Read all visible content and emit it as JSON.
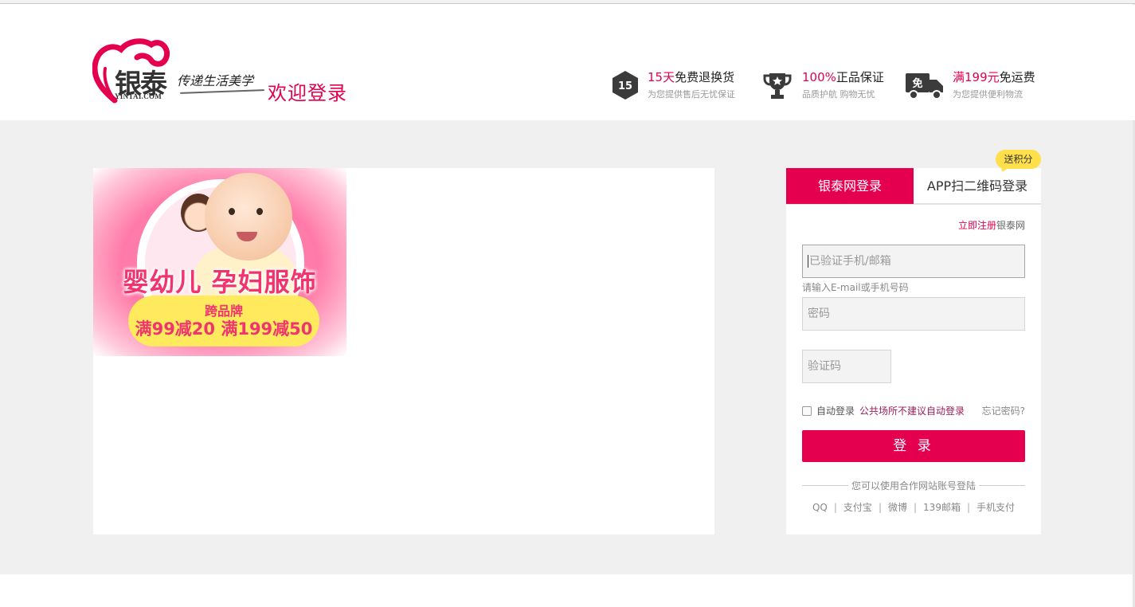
{
  "header": {
    "logo_cn": "银泰",
    "logo_en": "YINTAI.COM",
    "slogan": "传递生活美学",
    "welcome": "欢迎登录",
    "promos": [
      {
        "icon": "return-15-icon",
        "badge": "15",
        "highlight": "15天",
        "title": "免费退换货",
        "subtitle": "为您提供售后无忧保证"
      },
      {
        "icon": "trophy-icon",
        "highlight": "100%",
        "title": "正品保证",
        "subtitle": "品质护航 购物无忧"
      },
      {
        "icon": "truck-icon",
        "badge": "免",
        "highlight": "满199元",
        "title": "免运费",
        "subtitle": "为您提供便利物流"
      }
    ]
  },
  "banner": {
    "title": "婴幼儿 孕妇服饰",
    "pill_line1": "跨品牌",
    "pill_line2": "满99减20 满199减50"
  },
  "login": {
    "tabs": [
      {
        "label": "银泰网登录",
        "active": true
      },
      {
        "label": "APP扫二维码登录",
        "active": false
      }
    ],
    "points_tag": "送积分",
    "register_link": "立即注册",
    "register_suffix": "银泰网",
    "account_placeholder": "已验证手机/邮箱",
    "account_hint": "请输入E-mail或手机号码",
    "password_placeholder": "密码",
    "captcha_placeholder": "验证码",
    "auto_login": "自动登录",
    "public_warning": "公共场所不建议自动登录",
    "forgot": "忘记密码?",
    "submit": "登 录",
    "partner_title": "您可以使用合作网站账号登陆",
    "partners": [
      "QQ",
      "支付宝",
      "微博",
      "139邮箱",
      "手机支付"
    ]
  },
  "colors": {
    "brand": "#e4004f",
    "band": "#f0f0f0",
    "tag": "#ffe04a"
  }
}
